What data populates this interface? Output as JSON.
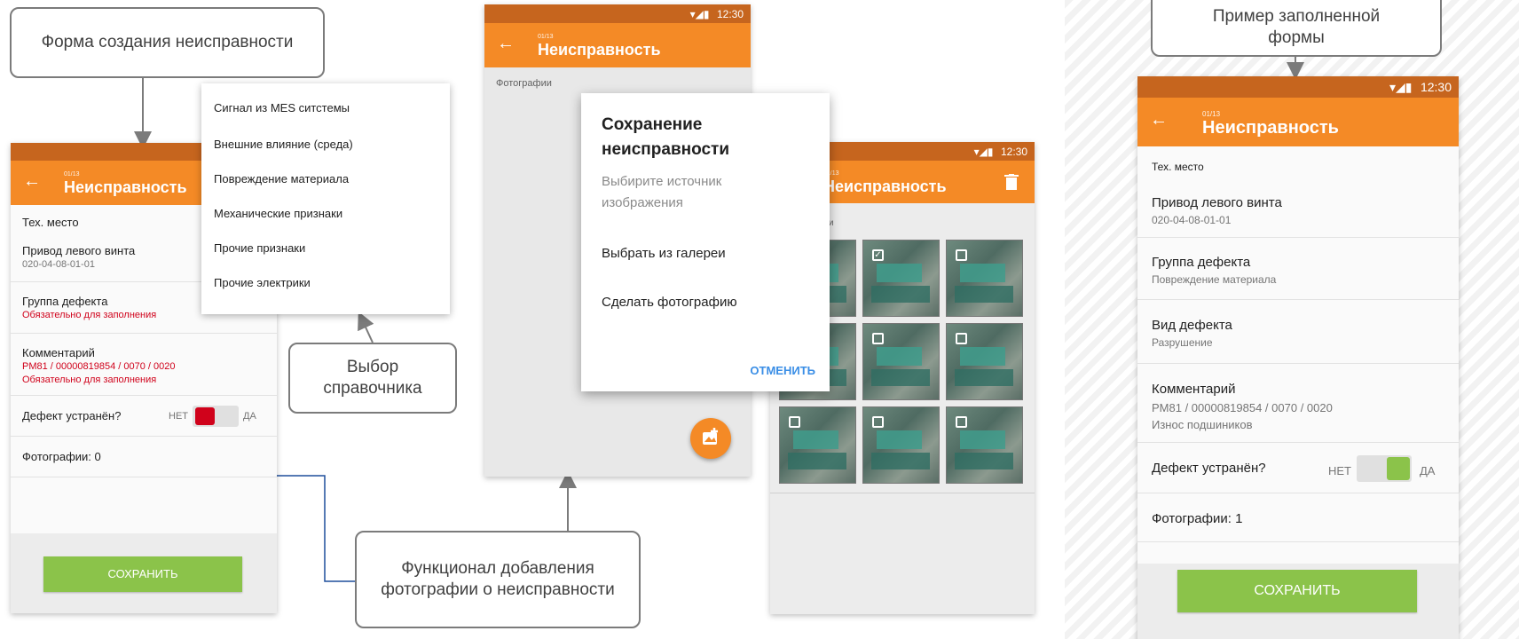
{
  "status_time": "12:30",
  "status_icons": "▾◢▮",
  "app": {
    "back_glyph": "←",
    "counter": "01/13",
    "title": "Неисправность"
  },
  "callouts": {
    "form_create": "Форма создания неисправности",
    "catalog_select": "Выбор справочника",
    "photo_function": "Функционал добавления фотографии о неисправности",
    "filled_example": "Пример заполненной формы"
  },
  "form": {
    "tech_place_label": "Тех. место",
    "tech_place_title": "Привод левого винта",
    "tech_place_code": "020-04-08-01-01",
    "defect_group_label": "Группа дефекта",
    "required_text": "Обязательно для заполнения",
    "comment_label": "Комментарий",
    "comment_code": "PM81 / 00000819854 / 0070 / 0020",
    "fixed_label": "Дефект устранён?",
    "no_label": "НЕТ",
    "yes_label": "ДА",
    "photos_label": "Фотографии:",
    "photos_count": "0",
    "save_label": "СОХРАНИТЬ"
  },
  "dropdown": {
    "items": [
      "Сигнал из MES ситстемы",
      "Внешние влияние (среда)",
      "Повреждение материала",
      "Механические признаки",
      "Прочие признаки",
      "Прочие электрики"
    ]
  },
  "dialog": {
    "section_label": "Фотографии",
    "title": "Сохранение неисправности",
    "subtitle": "Выбирите источник изображения",
    "option_gallery": "Выбрать из галереи",
    "option_camera": "Сделать фотографию",
    "cancel_label": "ОТМЕНИТЬ",
    "fab_icon": "add-photo-icon"
  },
  "gallery": {
    "section_label_partial": "фии",
    "trash_icon": "trash-icon",
    "thumbs_checked": [
      false,
      true,
      false,
      false,
      false,
      false,
      false,
      false,
      false
    ]
  },
  "filled": {
    "tech_place_label": "Тех. место",
    "tech_place_title": "Привод левого винта",
    "tech_place_code": "020-04-08-01-01",
    "defect_group_label": "Группа дефекта",
    "defect_group_value": "Повреждение материала",
    "defect_type_label": "Вид дефекта",
    "defect_type_value": "Разрушение",
    "comment_label": "Комментарий",
    "comment_code": "PM81 / 00000819854 / 0070 / 0020",
    "comment_text": "Износ подшиников",
    "fixed_label": "Дефект устранён?",
    "no_label": "НЕТ",
    "yes_label": "ДА",
    "photos_label": "Фотографии:",
    "photos_count": "1",
    "save_label": "СОХРАНИТЬ"
  },
  "colors": {
    "appbar": "#f48a26",
    "statusbar": "#c6651e",
    "save": "#8bc34a",
    "required": "#d0021b",
    "toggle_off": "#d0021b",
    "toggle_on": "#8bc34a",
    "cancel": "#3a8ee6"
  }
}
